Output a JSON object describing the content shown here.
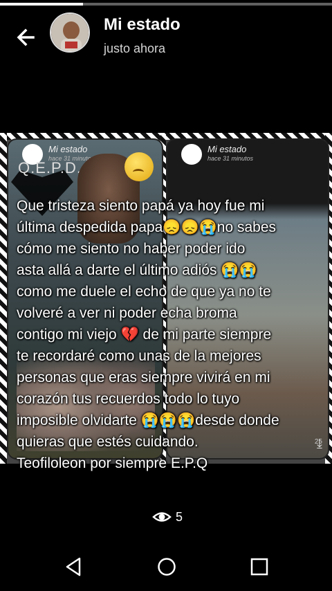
{
  "progress": {
    "fraction": 0.25
  },
  "header": {
    "title": "Mi estado",
    "subtitle": "justo ahora",
    "back_icon": "arrow-left-icon"
  },
  "media": {
    "left_panel": {
      "title": "Mi estado",
      "time": "hace 31 minutos",
      "overlay": "Q.E.P.D."
    },
    "right_panel": {
      "title": "Mi estado",
      "time": "hace 31 minutos",
      "views": "25"
    }
  },
  "caption": "Que tristeza siento papá ya hoy fue mi\núltima despedida papa😞😞😭no sabes\ncómo me siento no haber poder ido\nasta allá a darte el último adiós 😭😭\ncomo me duele el echo de que ya no te\nvolveré a ver ni poder echa broma\ncontigo mi viejo 💔 de mi parte siempre\nte recordaré como unas de la mejores\npersonas que eras siempre vivirá en mi\ncorazón tus recuerdos todo lo tuyo\nimposible olvidarte 😭😭😭desde donde\nquieras que estés cuidando.\nTeofiloleon por siempre E.P.Q",
  "views": {
    "count": "5",
    "icon": "eye-icon"
  },
  "navbar": {
    "back_icon": "triangle-back-icon",
    "home_icon": "circle-home-icon",
    "recent_icon": "square-recent-icon"
  },
  "colors": {
    "background": "#000000",
    "text": "#ffffff",
    "subtitle": "#d6d6d6"
  }
}
